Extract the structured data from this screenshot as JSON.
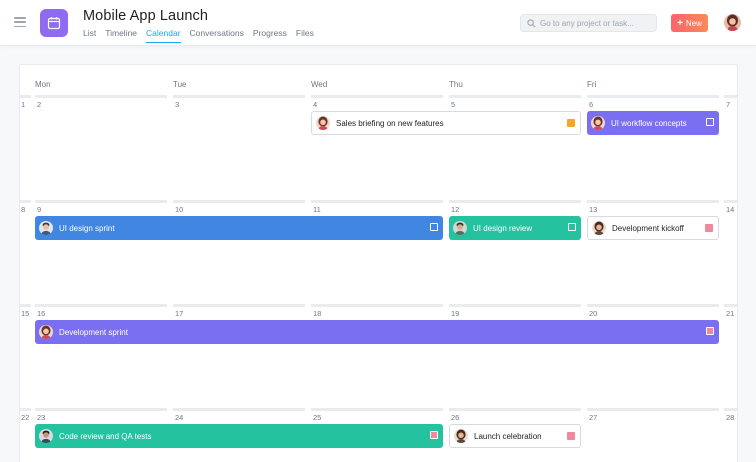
{
  "header": {
    "title": "Mobile App Launch",
    "tabs": [
      "List",
      "Timeline",
      "Calendar",
      "Conversations",
      "Progress",
      "Files"
    ],
    "active_tab": "Calendar",
    "search_placeholder": "Go to any project or task...",
    "new_label": "New"
  },
  "calendar": {
    "weekdays": [
      "Mon",
      "Tue",
      "Wed",
      "Thu",
      "Fri"
    ],
    "weeks": [
      {
        "days": [
          "1",
          "2",
          "3",
          "4",
          "5",
          "6",
          "7"
        ]
      },
      {
        "days": [
          "8",
          "9",
          "10",
          "11",
          "12",
          "13",
          "14"
        ]
      },
      {
        "days": [
          "15",
          "16",
          "17",
          "18",
          "19",
          "20",
          "21"
        ]
      },
      {
        "days": [
          "22",
          "23",
          "24",
          "25",
          "26",
          "27",
          "28"
        ]
      }
    ],
    "tasks": [
      {
        "name": "Sales briefing on new features",
        "style": "outline",
        "color": "#ffffff",
        "check": "#f5a623",
        "avatar": "woman1"
      },
      {
        "name": "UI workflow concepts",
        "style": "filled",
        "color": "#7a6ff0",
        "check": "#ffffff",
        "avatar": "woman1"
      },
      {
        "name": "UI design sprint",
        "style": "filled",
        "color": "#4186e0",
        "check": "#ffffff",
        "avatar": "man1"
      },
      {
        "name": "UI design review",
        "style": "filled",
        "color": "#25c2a0",
        "check": "#ffffff",
        "avatar": "man2"
      },
      {
        "name": "Development kickoff",
        "style": "outline",
        "color": "#ffffff",
        "check": "#f0889e",
        "avatar": "woman2"
      },
      {
        "name": "Development sprint",
        "style": "filled",
        "color": "#7a6ff0",
        "check": "#f0889e",
        "avatar": "woman1"
      },
      {
        "name": "Code review and QA tests",
        "style": "filled",
        "color": "#25c2a0",
        "check": "#f0889e",
        "avatar": "man3"
      },
      {
        "name": "Launch celebration",
        "style": "outline",
        "color": "#ffffff",
        "check": "#f0889e",
        "avatar": "woman2"
      }
    ]
  }
}
